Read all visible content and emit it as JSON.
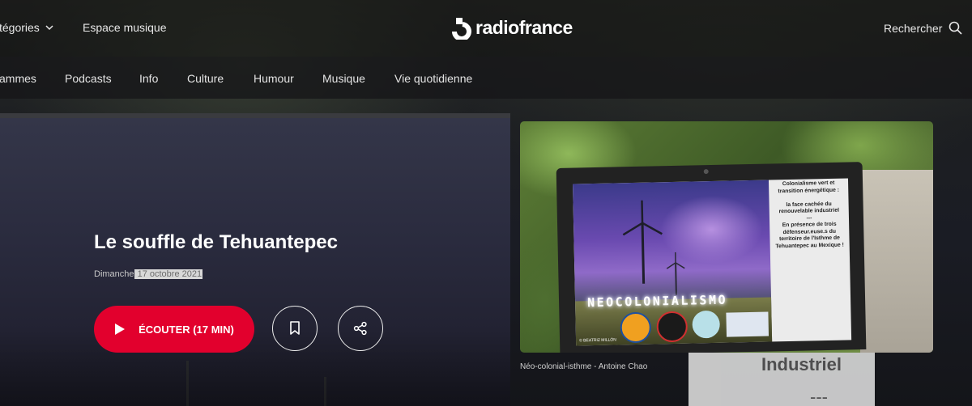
{
  "header": {
    "categories_label": "tégories",
    "espace_musique_label": "Espace musique",
    "logo_text": "radiofrance",
    "search_label": "Rechercher"
  },
  "nav": {
    "items": [
      {
        "label": "ammes"
      },
      {
        "label": "Podcasts"
      },
      {
        "label": "Info"
      },
      {
        "label": "Culture"
      },
      {
        "label": "Humour"
      },
      {
        "label": "Musique"
      },
      {
        "label": "Vie quotidienne"
      }
    ]
  },
  "episode": {
    "title": "Le souffle de Tehuantepec",
    "day": "Dimanche",
    "date": " 17 octobre 2021",
    "listen_label": "ÉCOUTER (17 MIN)"
  },
  "cover": {
    "caption": "Néo-colonial-isthme - Antoine Chao",
    "slide_title": "NEOCOLONIALISMO",
    "slide_text": "Colonialisme vert et transition énergétique :\n\nla face cachée du renouvelable industriel\n---\nEn présence de trois défenseur.euse.s du territoire de l'Isthme de Tehuantepec au Mexique !",
    "copyright": "© BEATRIZ MILLÓN"
  },
  "background": {
    "slide_word": "Industriel",
    "slide_dash": "---"
  },
  "colors": {
    "accent": "#e2002d",
    "background": "#141519",
    "text": "#ffffff"
  },
  "icons": [
    "chevron-down-icon",
    "radiofrance-logo-icon",
    "search-icon",
    "play-icon",
    "bookmark-icon",
    "share-icon"
  ]
}
